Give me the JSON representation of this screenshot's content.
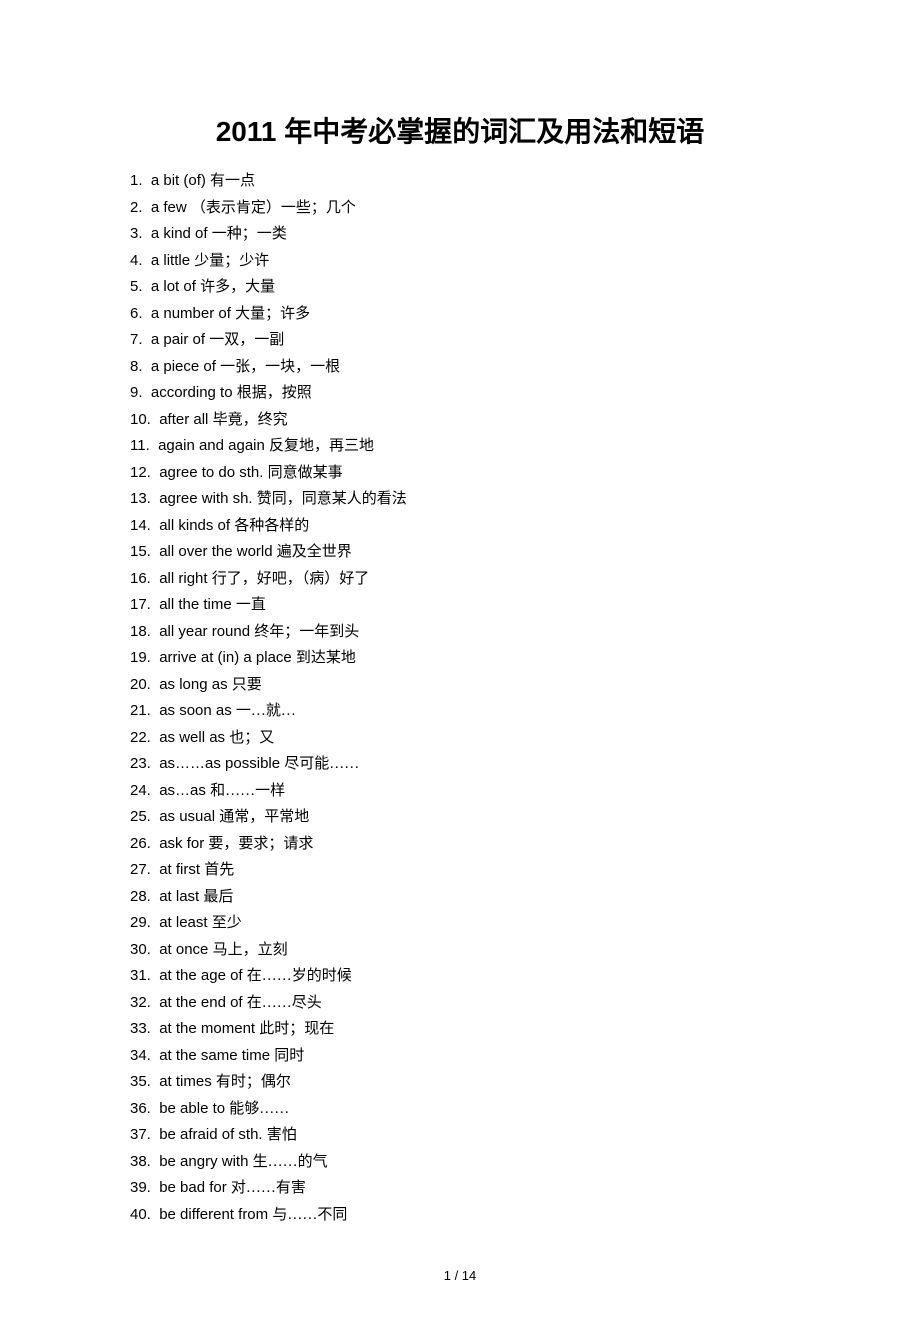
{
  "title": "2011 年中考必掌握的词汇及用法和短语",
  "items": [
    {
      "num": "1.",
      "en": "a bit (of)",
      "zh": "有一点"
    },
    {
      "num": "2.",
      "en": "a few",
      "zh": "（表示肯定）一些；几个"
    },
    {
      "num": "3.",
      "en": "a kind of",
      "zh": "一种；一类"
    },
    {
      "num": "4.",
      "en": "a little",
      "zh": "少量；少许"
    },
    {
      "num": "5.",
      "en": "a lot of",
      "zh": "许多，大量"
    },
    {
      "num": "6.",
      "en": "a number of",
      "zh": "大量；许多"
    },
    {
      "num": "7.",
      "en": "a pair of",
      "zh": "一双，一副"
    },
    {
      "num": "8.",
      "en": "a piece of",
      "zh": "一张，一块，一根"
    },
    {
      "num": "9.",
      "en": "according to",
      "zh": "根据，按照"
    },
    {
      "num": "10.",
      "en": "after all",
      "zh": "毕竟，终究"
    },
    {
      "num": "11.",
      "en": "again and again",
      "zh": "反复地，再三地"
    },
    {
      "num": "12.",
      "en": "agree to do sth.",
      "zh": "同意做某事"
    },
    {
      "num": "13.",
      "en": "agree with sh.",
      "zh": "赞同，同意某人的看法"
    },
    {
      "num": "14.",
      "en": "all kinds of",
      "zh": "各种各样的"
    },
    {
      "num": "15.",
      "en": "all over the world",
      "zh": "遍及全世界"
    },
    {
      "num": "16.",
      "en": "all right",
      "zh": "行了，好吧，（病）好了"
    },
    {
      "num": "17.",
      "en": "all the time",
      "zh": "一直"
    },
    {
      "num": "18.",
      "en": "all year round",
      "zh": "终年；一年到头"
    },
    {
      "num": "19.",
      "en": "arrive at (in) a place",
      "zh": "到达某地"
    },
    {
      "num": "20.",
      "en": "as long as",
      "zh": "只要"
    },
    {
      "num": "21.",
      "en": "as soon as",
      "zh": "一…就…"
    },
    {
      "num": "22.",
      "en": "as well as",
      "zh": "也；又"
    },
    {
      "num": "23.",
      "en": "as……as possible",
      "zh": "尽可能……"
    },
    {
      "num": "24.",
      "en": "as…as",
      "zh": "和……一样"
    },
    {
      "num": "25.",
      "en": "as usual",
      "zh": "通常，平常地"
    },
    {
      "num": "26.",
      "en": "ask for",
      "zh": "要，要求；请求"
    },
    {
      "num": "27.",
      "en": "at first",
      "zh": "首先"
    },
    {
      "num": "28.",
      "en": "at last",
      "zh": "最后"
    },
    {
      "num": "29.",
      "en": "at least",
      "zh": "至少"
    },
    {
      "num": "30.",
      "en": "at once",
      "zh": "马上，立刻"
    },
    {
      "num": "31.",
      "en": "at the age of",
      "zh": "在……岁的时候"
    },
    {
      "num": "32.",
      "en": "at the end of",
      "zh": "在……尽头"
    },
    {
      "num": "33.",
      "en": "at the moment",
      "zh": "此时；现在"
    },
    {
      "num": "34.",
      "en": "at the same time",
      "zh": "同时"
    },
    {
      "num": "35.",
      "en": "at times",
      "zh": "有时；偶尔"
    },
    {
      "num": "36.",
      "en": "be able to",
      "zh": "能够……"
    },
    {
      "num": "37.",
      "en": "be afraid of sth.",
      "zh": "害怕"
    },
    {
      "num": "38.",
      "en": "be angry with",
      "zh": "生……的气"
    },
    {
      "num": "39.",
      "en": "be bad for",
      "zh": "对……有害"
    },
    {
      "num": "40.",
      "en": "be different from",
      "zh": "与……不同"
    }
  ],
  "footer": "1 / 14"
}
